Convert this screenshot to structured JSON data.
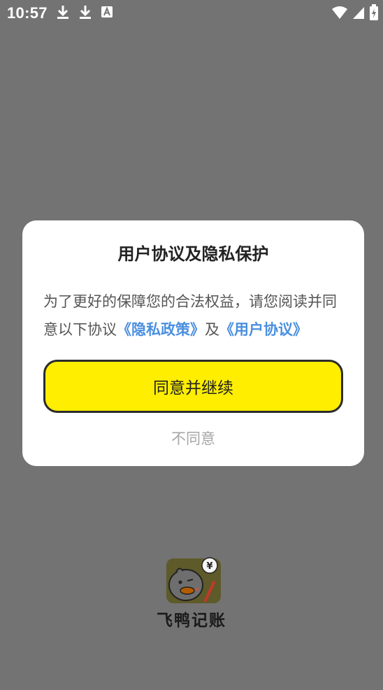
{
  "status_bar": {
    "time": "10:57",
    "left_icons": [
      "download-icon",
      "download-icon",
      "text-a-icon"
    ],
    "right_icons": [
      "wifi-icon",
      "signal-icon",
      "battery-charging-icon"
    ]
  },
  "dialog": {
    "title": "用户协议及隐私保护",
    "message_prefix": "为了更好的保障您的合法权益，请您阅读并同意以下协议",
    "privacy_link": "《隐私政策》",
    "conjunction": "及",
    "user_agreement_link": "《用户协议》",
    "agree_label": "同意并继续",
    "disagree_label": "不同意"
  },
  "app": {
    "name": "飞鸭记账",
    "logo_icon": "duck-yen-logo"
  },
  "colors": {
    "overlay": "#737373",
    "accent_yellow": "#ffee00",
    "link_blue": "#4a8fe0"
  }
}
